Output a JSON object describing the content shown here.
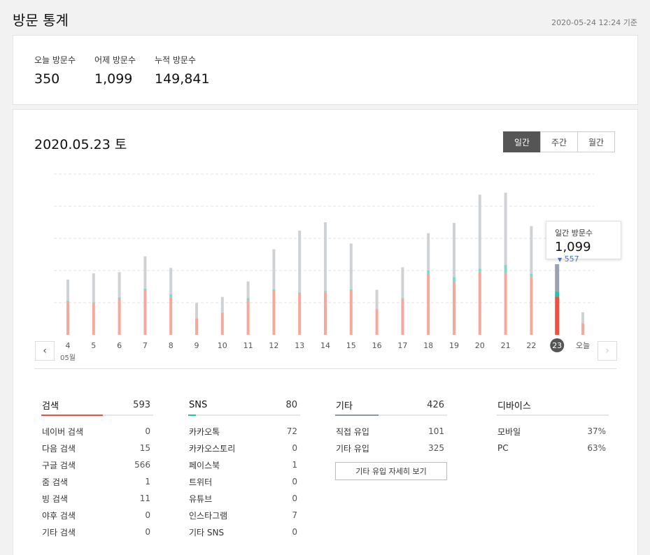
{
  "header": {
    "title": "방문 통계",
    "timestamp": "2020-05-24 12:24 기준"
  },
  "summary": {
    "today": {
      "label": "오늘 방문수",
      "value": "350"
    },
    "yesterday": {
      "label": "어제 방문수",
      "value": "1,099"
    },
    "total": {
      "label": "누적 방문수",
      "value": "149,841"
    }
  },
  "main": {
    "date_title": "2020.05.23 토",
    "tabs": [
      "일간",
      "주간",
      "월간"
    ],
    "active_tab": "일간",
    "month_label": "05월",
    "tooltip": {
      "label": "일간 방문수",
      "value": "1,099",
      "diff": "557"
    }
  },
  "colors": {
    "search": "#f4a99d",
    "search_selected": "#f0503f",
    "sns": "#7fd8cc",
    "sns_selected": "#1ec5ad",
    "other": "#cfd2d5",
    "other_selected": "#9aa3ad",
    "etc_underline": "#8a96a8"
  },
  "chart_data": {
    "type": "bar",
    "stacked": true,
    "categories": [
      "4",
      "5",
      "6",
      "7",
      "8",
      "9",
      "10",
      "11",
      "12",
      "13",
      "14",
      "15",
      "16",
      "17",
      "18",
      "19",
      "20",
      "21",
      "22",
      "23",
      "오늘"
    ],
    "series": [
      {
        "name": "검색",
        "values": [
          510,
          490,
          560,
          690,
          590,
          250,
          340,
          530,
          690,
          640,
          660,
          690,
          400,
          550,
          940,
          820,
          980,
          960,
          900,
          593,
          180
        ]
      },
      {
        "name": "SNS",
        "values": [
          20,
          15,
          25,
          30,
          40,
          5,
          10,
          40,
          20,
          20,
          20,
          20,
          10,
          20,
          60,
          80,
          50,
          130,
          50,
          80,
          0
        ]
      },
      {
        "name": "기타",
        "values": [
          330,
          450,
          390,
          500,
          410,
          240,
          240,
          260,
          620,
          960,
          1070,
          710,
          290,
          480,
          580,
          840,
          1150,
          1120,
          740,
          426,
          170
        ]
      }
    ],
    "selected": "23",
    "ylim": [
      0,
      2500
    ],
    "grid": true
  },
  "stats": {
    "search": {
      "title": "검색",
      "total": "593",
      "share": 0.55,
      "rows": [
        {
          "label": "네이버 검색",
          "value": "0"
        },
        {
          "label": "다음 검색",
          "value": "15"
        },
        {
          "label": "구글 검색",
          "value": "566"
        },
        {
          "label": "줌 검색",
          "value": "1"
        },
        {
          "label": "빙 검색",
          "value": "11"
        },
        {
          "label": "야후 검색",
          "value": "0"
        },
        {
          "label": "기타 검색",
          "value": "0"
        }
      ]
    },
    "sns": {
      "title": "SNS",
      "total": "80",
      "share": 0.07,
      "rows": [
        {
          "label": "카카오톡",
          "value": "72"
        },
        {
          "label": "카카오스토리",
          "value": "0"
        },
        {
          "label": "페이스북",
          "value": "1"
        },
        {
          "label": "트위터",
          "value": "0"
        },
        {
          "label": "유튜브",
          "value": "0"
        },
        {
          "label": "인스타그램",
          "value": "7"
        },
        {
          "label": "기타 SNS",
          "value": "0"
        }
      ]
    },
    "etc": {
      "title": "기타",
      "total": "426",
      "share": 0.39,
      "rows": [
        {
          "label": "직접 유입",
          "value": "101"
        },
        {
          "label": "기타 유입",
          "value": "325"
        }
      ],
      "detail_button": "기타 유입 자세히 보기"
    },
    "device": {
      "title": "디바이스",
      "rows": [
        {
          "label": "모바일",
          "value": "37%"
        },
        {
          "label": "PC",
          "value": "63%"
        }
      ]
    }
  }
}
